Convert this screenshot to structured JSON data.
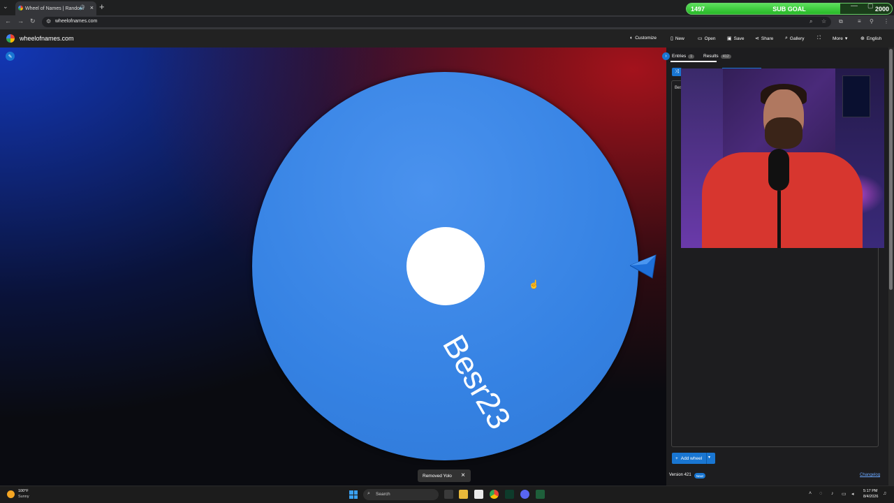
{
  "browser": {
    "tab_title": "Wheel of Names | Random",
    "url": "wheelofnames.com"
  },
  "sub_goal": {
    "current": "1497",
    "label": "SUB GOAL",
    "target": "2000",
    "progress": 0.7485
  },
  "app": {
    "site_name": "wheelofnames.com",
    "menu": [
      {
        "label": "Customize",
        "icon": "palette-icon"
      },
      {
        "label": "New",
        "icon": "file-icon"
      },
      {
        "label": "Open",
        "icon": "folder-icon"
      },
      {
        "label": "Save",
        "icon": "save-icon"
      },
      {
        "label": "Share",
        "icon": "share-icon"
      },
      {
        "label": "Gallery",
        "icon": "search-icon"
      },
      {
        "label": "",
        "icon": "fullscreen-icon"
      },
      {
        "label": "More",
        "icon": "chevron-down-icon"
      },
      {
        "label": "English",
        "icon": "globe-icon"
      }
    ]
  },
  "wheel": {
    "entry_text": "Besr23",
    "color": "#3582e3"
  },
  "toast": {
    "message": "Removed Yolo"
  },
  "panel": {
    "tabs": [
      {
        "label": "Entries",
        "count": "1"
      },
      {
        "label": "Results",
        "count": "412"
      }
    ],
    "first_entry": "Bes",
    "add_wheel_label": "Add wheel",
    "version": "Version 421",
    "new_badge": "New!",
    "changelog": "Changelog"
  },
  "taskbar": {
    "weather_temp": "100°F",
    "weather_cond": "Sunny",
    "search_label": "Search",
    "time": "5:17 PM",
    "date": "8/4/2026"
  }
}
